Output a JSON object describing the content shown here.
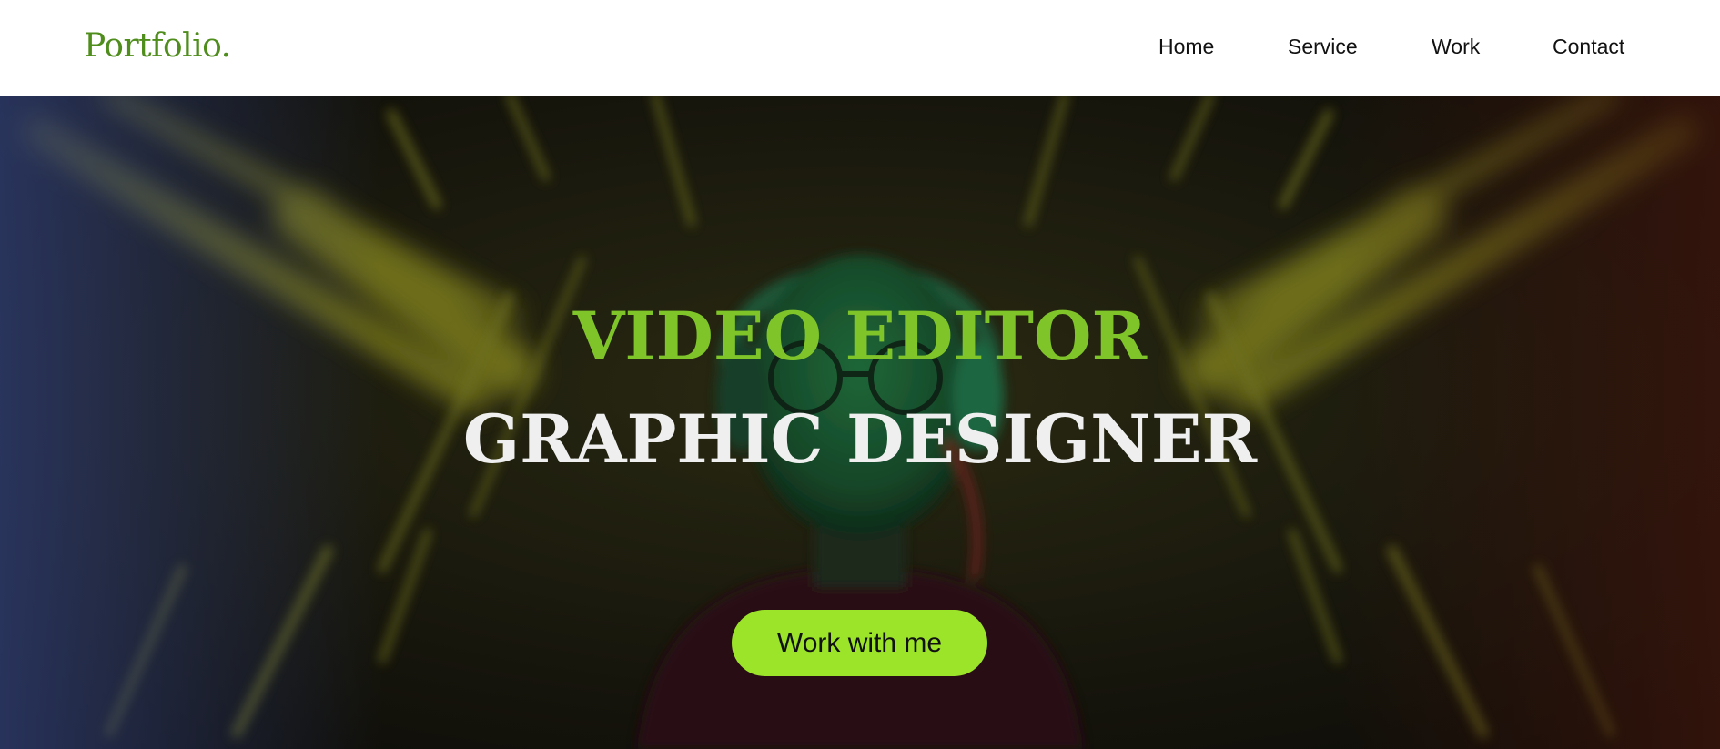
{
  "brand": {
    "logo": "Portfolio."
  },
  "nav": {
    "items": [
      "Home",
      "Service",
      "Work",
      "Contact"
    ]
  },
  "hero": {
    "headline_primary": "VIDEO EDITOR",
    "headline_secondary": "GRAPHIC DESIGNER",
    "cta_label": "Work with me",
    "background": "photo-of-person-with-headphones-and-neon-lights"
  },
  "colors": {
    "accent": "#7fc52a",
    "cta": "#9be42a",
    "logo": "#4f8d1c",
    "hero_text": "#efefef"
  }
}
